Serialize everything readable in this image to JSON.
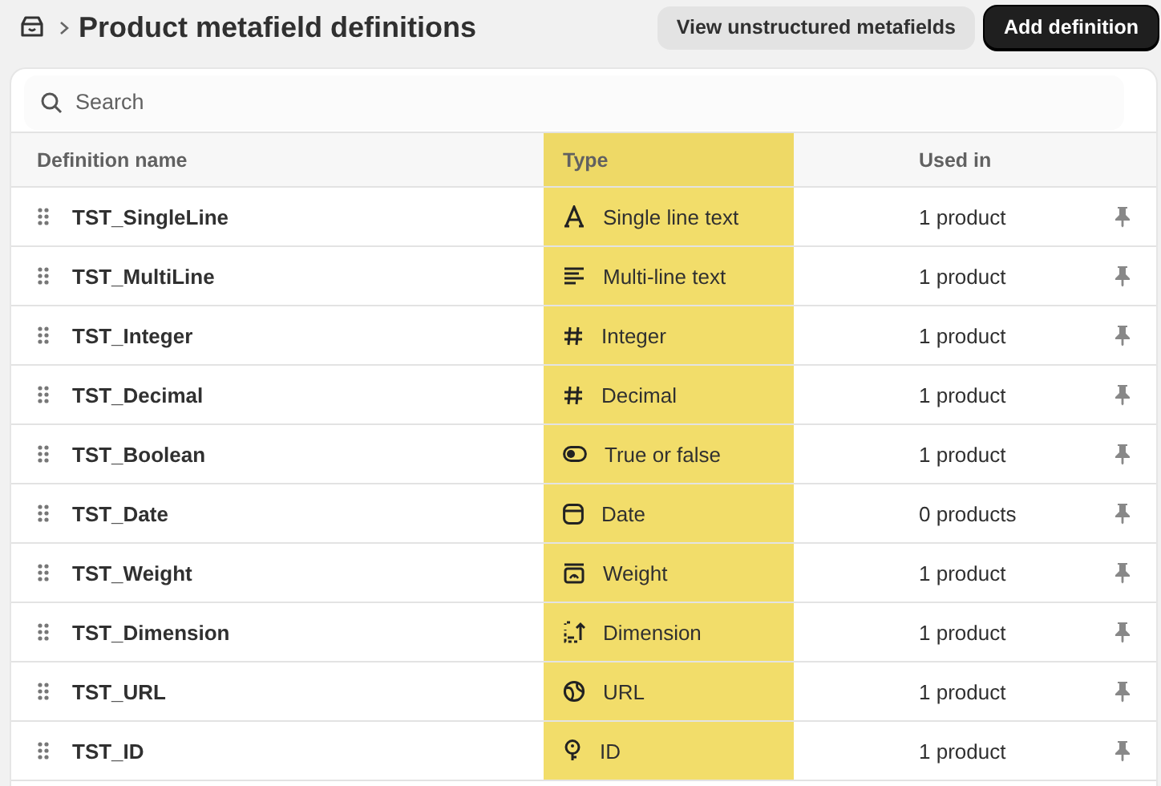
{
  "header": {
    "title": "Product metafield definitions",
    "buttons": [
      {
        "label": "View unstructured metafields",
        "kind": "secondary"
      },
      {
        "label": "Add definition",
        "kind": "primary"
      }
    ]
  },
  "search": {
    "placeholder": "Search"
  },
  "table": {
    "columns": [
      {
        "label": "Definition name",
        "highlighted": false
      },
      {
        "label": "Type",
        "highlighted": true
      },
      {
        "label": "Used in",
        "highlighted": false
      }
    ],
    "rows": [
      {
        "name": "TST_SingleLine",
        "kind": "single_line",
        "type": "Single line text",
        "used_in": "1 product"
      },
      {
        "name": "TST_MultiLine",
        "kind": "multi_line",
        "type": "Multi-line text",
        "used_in": "1 product"
      },
      {
        "name": "TST_Integer",
        "kind": "integer",
        "type": "Integer",
        "used_in": "1 product"
      },
      {
        "name": "TST_Decimal",
        "kind": "decimal",
        "type": "Decimal",
        "used_in": "1 product"
      },
      {
        "name": "TST_Boolean",
        "kind": "boolean",
        "type": "True or false",
        "used_in": "1 product"
      },
      {
        "name": "TST_Date",
        "kind": "date",
        "type": "Date",
        "used_in": "0 products"
      },
      {
        "name": "TST_Weight",
        "kind": "weight",
        "type": "Weight",
        "used_in": "1 product"
      },
      {
        "name": "TST_Dimension",
        "kind": "dimension",
        "type": "Dimension",
        "used_in": "1 product"
      },
      {
        "name": "TST_URL",
        "kind": "url",
        "type": "URL",
        "used_in": "1 product"
      },
      {
        "name": "TST_ID",
        "kind": "id",
        "type": "ID",
        "used_in": "1 product"
      }
    ]
  }
}
